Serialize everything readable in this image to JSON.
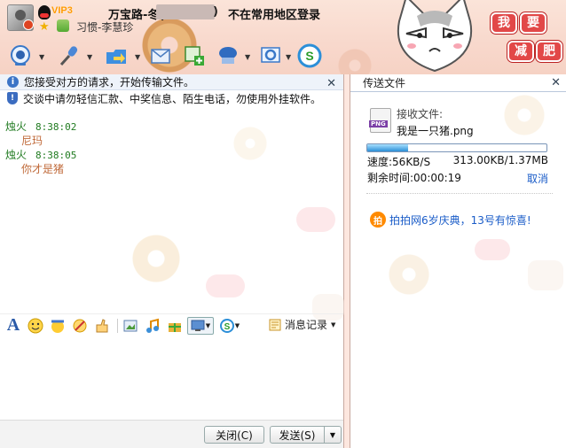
{
  "header": {
    "vip": "VIP3",
    "contact_name": "万宝路-冬(",
    "paren_close": ")",
    "location_note": "不在常用地区登录",
    "signature": "习惯-李慧珍",
    "bubble_labels": [
      "我",
      "要",
      "减",
      "肥"
    ]
  },
  "toolbar": {
    "icons": [
      "video-call-icon",
      "voice-call-icon",
      "send-file-icon",
      "email-icon",
      "add-app-icon",
      "remote-assist-icon",
      "settings-icon",
      "soso-icon"
    ]
  },
  "chat": {
    "notice_1": "您接受对方的请求，开始传输文件。",
    "notice_2": "交谈中请勿轻信汇款、中奖信息、陌生电话，勿使用外挂软件。",
    "messages": [
      {
        "sender": "烛火",
        "time": "8:38:02",
        "text": "尼玛"
      },
      {
        "sender": "烛火",
        "time": "8:38:05",
        "text": "你才是猪"
      }
    ],
    "history_label": "消息记录",
    "close_label": "关闭(C)",
    "send_label": "发送(S)"
  },
  "transfer": {
    "title": "传送文件",
    "receive_label": "接收文件:",
    "file_name": "我是一只猪.png",
    "file_type": "PNG",
    "progress": 0.23,
    "speed": "速度:56KB/S",
    "size": "313.00KB/1.37MB",
    "remaining": "剩余时间:00:00:19",
    "cancel_label": "取消",
    "promo_icon_label": "拍",
    "promo_text": "拍拍网6岁庆典，13号有惊喜!"
  },
  "colors": {
    "accent_blue": "#1a5cc8",
    "sender_green": "#1f7a1f",
    "message_orange": "#c06a3a",
    "header_pink": "#f8d8cc"
  }
}
